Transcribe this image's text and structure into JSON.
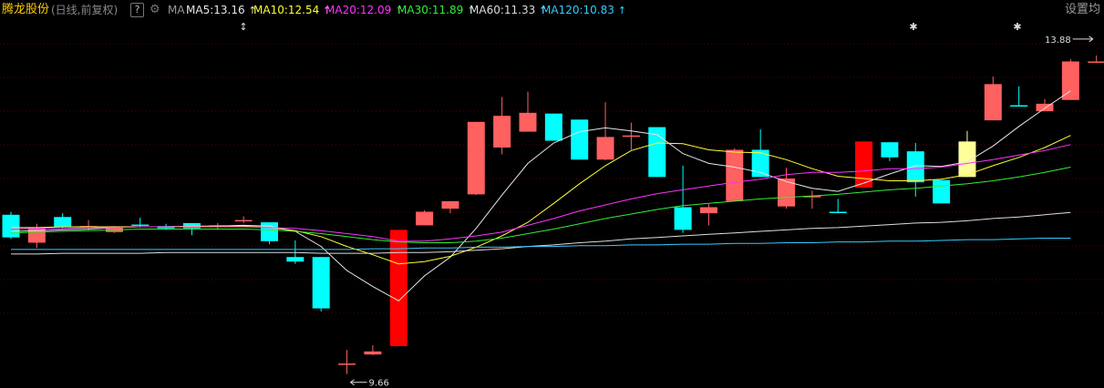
{
  "header": {
    "stock_name": "腾龙股份",
    "period": "(日线,前复权)",
    "help": "?",
    "ma_label": "MA",
    "settings": "设置均",
    "ma5": "MA5:13.16",
    "ma10": "MA10:12.54",
    "ma20": "MA20:12.09",
    "ma30": "MA30:11.89",
    "ma60": "MA60:11.33",
    "ma120": "MA120:10.83",
    "arrow": "↑"
  },
  "colors": {
    "up": "#ff6060",
    "up_solid": "#ff0000",
    "down": "#00ffff",
    "highlight": "#ffff99",
    "ma5": "#e6e6e6",
    "ma10": "#ffff33",
    "ma20": "#ff33ff",
    "ma30": "#33ee33",
    "ma60": "#dddddd",
    "ma120": "#33ccff",
    "grid": "#5a0000"
  },
  "chart_data": {
    "type": "candlestick",
    "ylim": [
      9.5,
      14.3
    ],
    "max_label": "13.88",
    "min_label": "9.66",
    "candles": [
      {
        "o": 11.77,
        "h": 11.81,
        "l": 11.45,
        "c": 11.47,
        "dir": "down"
      },
      {
        "o": 11.4,
        "h": 11.65,
        "l": 11.33,
        "c": 11.6,
        "dir": "up"
      },
      {
        "o": 11.74,
        "h": 11.79,
        "l": 11.59,
        "c": 11.61,
        "dir": "down"
      },
      {
        "o": 11.62,
        "h": 11.7,
        "l": 11.57,
        "c": 11.62,
        "dir": "up"
      },
      {
        "o": 11.54,
        "h": 11.62,
        "l": 11.53,
        "c": 11.6,
        "dir": "up"
      },
      {
        "o": 11.64,
        "h": 11.73,
        "l": 11.6,
        "c": 11.64,
        "dir": "down"
      },
      {
        "o": 11.62,
        "h": 11.65,
        "l": 11.57,
        "c": 11.59,
        "dir": "down"
      },
      {
        "o": 11.66,
        "h": 11.66,
        "l": 11.5,
        "c": 11.59,
        "dir": "down"
      },
      {
        "o": 11.62,
        "h": 11.66,
        "l": 11.57,
        "c": 11.63,
        "dir": "up"
      },
      {
        "o": 11.7,
        "h": 11.75,
        "l": 11.66,
        "c": 11.7,
        "dir": "up"
      },
      {
        "o": 11.67,
        "h": 11.67,
        "l": 11.38,
        "c": 11.42,
        "dir": "down"
      },
      {
        "o": 11.21,
        "h": 11.43,
        "l": 11.12,
        "c": 11.15,
        "dir": "down"
      },
      {
        "o": 11.21,
        "h": 11.21,
        "l": 10.49,
        "c": 10.53,
        "dir": "down"
      },
      {
        "o": 9.8,
        "h": 9.98,
        "l": 9.66,
        "c": 9.8,
        "dir": "up"
      },
      {
        "o": 9.92,
        "h": 10.04,
        "l": 9.91,
        "c": 9.96,
        "dir": "up"
      },
      {
        "o": 10.03,
        "h": 11.57,
        "l": 10.03,
        "c": 11.57,
        "dir": "up_solid"
      },
      {
        "o": 11.63,
        "h": 11.83,
        "l": 11.63,
        "c": 11.81,
        "dir": "up"
      },
      {
        "o": 11.85,
        "h": 11.95,
        "l": 11.79,
        "c": 11.95,
        "dir": "up"
      },
      {
        "o": 12.04,
        "h": 13.0,
        "l": 12.03,
        "c": 13.0,
        "dir": "up"
      },
      {
        "o": 12.66,
        "h": 13.33,
        "l": 12.57,
        "c": 13.08,
        "dir": "up"
      },
      {
        "o": 12.87,
        "h": 13.4,
        "l": 12.87,
        "c": 13.12,
        "dir": "up"
      },
      {
        "o": 13.11,
        "h": 13.11,
        "l": 12.75,
        "c": 12.75,
        "dir": "down"
      },
      {
        "o": 13.03,
        "h": 13.03,
        "l": 12.5,
        "c": 12.5,
        "dir": "down"
      },
      {
        "o": 12.5,
        "h": 13.26,
        "l": 12.49,
        "c": 12.8,
        "dir": "up"
      },
      {
        "o": 12.82,
        "h": 12.99,
        "l": 12.63,
        "c": 12.82,
        "dir": "up"
      },
      {
        "o": 12.93,
        "h": 12.93,
        "l": 12.27,
        "c": 12.27,
        "dir": "down"
      },
      {
        "o": 11.87,
        "h": 12.42,
        "l": 11.53,
        "c": 11.57,
        "dir": "down"
      },
      {
        "o": 11.79,
        "h": 11.91,
        "l": 11.63,
        "c": 11.87,
        "dir": "up"
      },
      {
        "o": 11.95,
        "h": 12.65,
        "l": 11.95,
        "c": 12.63,
        "dir": "up"
      },
      {
        "o": 12.63,
        "h": 12.9,
        "l": 12.27,
        "c": 12.27,
        "dir": "down"
      },
      {
        "o": 11.88,
        "h": 12.39,
        "l": 11.85,
        "c": 12.25,
        "dir": "up"
      },
      {
        "o": 12.02,
        "h": 12.09,
        "l": 11.85,
        "c": 12.0,
        "dir": "up"
      },
      {
        "o": 11.81,
        "h": 11.98,
        "l": 11.79,
        "c": 11.81,
        "dir": "down"
      },
      {
        "o": 12.13,
        "h": 12.74,
        "l": 12.13,
        "c": 12.74,
        "dir": "up_solid"
      },
      {
        "o": 12.73,
        "h": 12.73,
        "l": 12.48,
        "c": 12.53,
        "dir": "down"
      },
      {
        "o": 12.61,
        "h": 12.72,
        "l": 12.01,
        "c": 12.2,
        "dir": "down"
      },
      {
        "o": 12.23,
        "h": 12.23,
        "l": 11.92,
        "c": 11.92,
        "dir": "down"
      },
      {
        "o": 12.27,
        "h": 12.88,
        "l": 12.27,
        "c": 12.74,
        "dir": "highlight"
      },
      {
        "o": 13.02,
        "h": 13.6,
        "l": 13.02,
        "c": 13.5,
        "dir": "up"
      },
      {
        "o": 13.22,
        "h": 13.47,
        "l": 13.22,
        "c": 13.22,
        "dir": "down"
      },
      {
        "o": 13.14,
        "h": 13.3,
        "l": 13.14,
        "c": 13.24,
        "dir": "up"
      },
      {
        "o": 13.29,
        "h": 13.83,
        "l": 13.29,
        "c": 13.8,
        "dir": "up"
      },
      {
        "o": 13.8,
        "h": 13.88,
        "l": 13.8,
        "c": 13.8,
        "dir": "up"
      }
    ],
    "ma5": [
      11.55,
      11.56,
      11.57,
      11.58,
      11.6,
      11.61,
      11.61,
      11.61,
      11.62,
      11.63,
      11.62,
      11.55,
      11.35,
      11.03,
      10.82,
      10.63,
      10.96,
      11.21,
      11.59,
      12.03,
      12.45,
      12.72,
      12.87,
      12.92,
      12.88,
      12.83,
      12.58,
      12.45,
      12.4,
      12.33,
      12.21,
      12.12,
      12.08,
      12.19,
      12.31,
      12.42,
      12.41,
      12.47,
      12.68,
      12.94,
      13.18,
      13.41,
      13.16
    ],
    "ma10": [
      11.6,
      11.6,
      11.61,
      11.61,
      11.61,
      11.61,
      11.61,
      11.62,
      11.62,
      11.62,
      11.6,
      11.56,
      11.48,
      11.35,
      11.24,
      11.12,
      11.15,
      11.22,
      11.34,
      11.49,
      11.67,
      11.92,
      12.18,
      12.42,
      12.62,
      12.72,
      12.71,
      12.63,
      12.6,
      12.59,
      12.5,
      12.38,
      12.28,
      12.25,
      12.22,
      12.22,
      12.24,
      12.3,
      12.42,
      12.53,
      12.66,
      12.82,
      12.54
    ],
    "ma20": [
      11.58,
      11.59,
      11.59,
      11.6,
      11.6,
      11.61,
      11.61,
      11.61,
      11.61,
      11.61,
      11.6,
      11.59,
      11.56,
      11.52,
      11.48,
      11.42,
      11.42,
      11.45,
      11.49,
      11.54,
      11.63,
      11.72,
      11.82,
      11.9,
      11.98,
      12.05,
      12.1,
      12.15,
      12.2,
      12.24,
      12.3,
      12.33,
      12.33,
      12.35,
      12.38,
      12.38,
      12.4,
      12.45,
      12.5,
      12.56,
      12.62,
      12.7,
      12.09
    ],
    "ma30": [
      11.53,
      11.54,
      11.55,
      11.56,
      11.57,
      11.58,
      11.58,
      11.58,
      11.58,
      11.58,
      11.57,
      11.55,
      11.52,
      11.48,
      11.44,
      11.41,
      11.4,
      11.4,
      11.42,
      11.46,
      11.52,
      11.58,
      11.65,
      11.72,
      11.78,
      11.84,
      11.89,
      11.92,
      11.95,
      11.98,
      12.0,
      12.02,
      12.04,
      12.07,
      12.1,
      12.12,
      12.15,
      12.18,
      12.22,
      12.27,
      12.33,
      12.4,
      11.89
    ],
    "ma60": [
      11.25,
      11.25,
      11.26,
      11.26,
      11.26,
      11.26,
      11.27,
      11.27,
      11.27,
      11.27,
      11.27,
      11.27,
      11.26,
      11.26,
      11.26,
      11.27,
      11.27,
      11.28,
      11.3,
      11.32,
      11.35,
      11.37,
      11.4,
      11.42,
      11.45,
      11.47,
      11.49,
      11.51,
      11.53,
      11.55,
      11.57,
      11.59,
      11.6,
      11.62,
      11.64,
      11.66,
      11.67,
      11.69,
      11.72,
      11.74,
      11.77,
      11.8,
      11.33
    ],
    "ma120": [
      11.31,
      11.31,
      11.31,
      11.31,
      11.31,
      11.31,
      11.31,
      11.31,
      11.31,
      11.31,
      11.31,
      11.31,
      11.31,
      11.31,
      11.32,
      11.32,
      11.33,
      11.33,
      11.34,
      11.34,
      11.35,
      11.35,
      11.36,
      11.36,
      11.37,
      11.37,
      11.38,
      11.38,
      11.39,
      11.39,
      11.4,
      11.4,
      11.41,
      11.41,
      11.42,
      11.42,
      11.43,
      11.44,
      11.44,
      11.45,
      11.46,
      11.46,
      10.83
    ]
  }
}
